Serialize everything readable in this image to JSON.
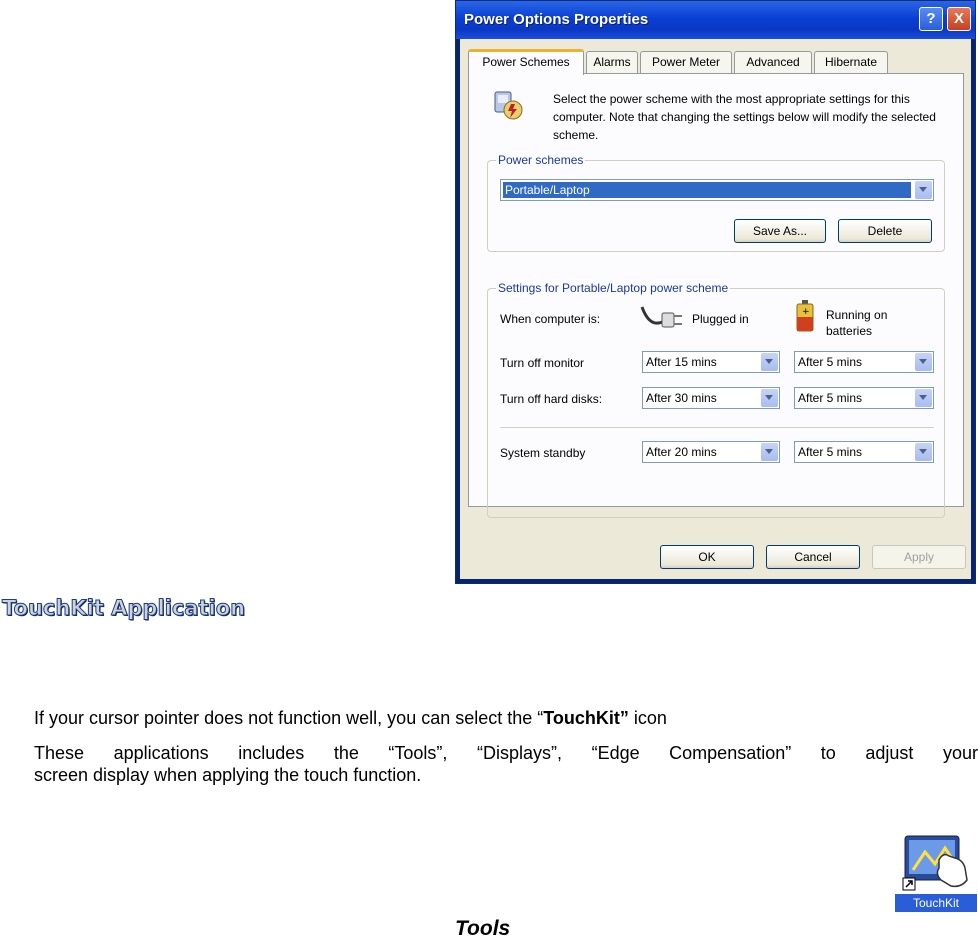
{
  "dialog": {
    "title": "Power Options Properties",
    "help_glyph": "?",
    "close_glyph": "X",
    "tabs": [
      {
        "label": "Power Schemes",
        "active": true
      },
      {
        "label": "Alarms",
        "active": false
      },
      {
        "label": "Power Meter",
        "active": false
      },
      {
        "label": "Advanced",
        "active": false
      },
      {
        "label": "Hibernate",
        "active": false
      }
    ],
    "intro_text": "Select the power scheme with the most appropriate settings for this computer. Note that changing the settings below will modify the selected scheme.",
    "power_schemes": {
      "group_label": "Power schemes",
      "selected": "Portable/Laptop",
      "save_as_label": "Save As...",
      "delete_label": "Delete"
    },
    "settings": {
      "group_label": "Settings for Portable/Laptop power scheme",
      "when_label": "When computer is:",
      "plugged_in_label": "Plugged in",
      "on_batteries_label": "Running on batteries",
      "rows": [
        {
          "label": "Turn off monitor",
          "plugged": "After 15 mins",
          "battery": "After 5 mins"
        },
        {
          "label": "Turn off hard disks:",
          "plugged": "After 30 mins",
          "battery": "After 5 mins"
        },
        {
          "label": "System standby",
          "plugged": "After 20 mins",
          "battery": "After 5 mins"
        }
      ]
    },
    "buttons": {
      "ok": "OK",
      "cancel": "Cancel",
      "apply": "Apply"
    }
  },
  "doc": {
    "heading": "TouchKit Application",
    "para1_before": "If your cursor pointer does not function well, you can select the “",
    "para1_bold": "TouchKit”",
    "para1_after": " icon",
    "para2_line1": "These applications includes the “Tools”, “Displays”, “Edge Compensation” to adjust your",
    "para2_line2": "screen display when applying the touch function.",
    "icon_label": "TouchKit",
    "tools_caption": "Tools"
  }
}
